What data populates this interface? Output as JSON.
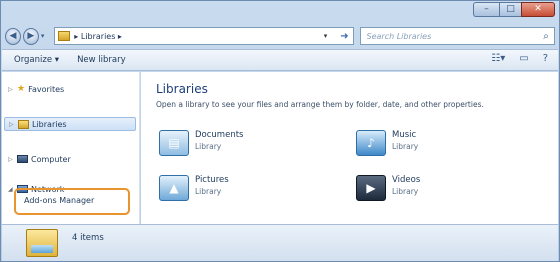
{
  "titlebar": {
    "minimize": "–",
    "maximize": "□",
    "close": "✕"
  },
  "address": {
    "path": "▸ Libraries ▸",
    "search_placeholder": "Search Libraries"
  },
  "toolbar": {
    "organize": "Organize ▾",
    "new_library": "New library"
  },
  "nav": {
    "favorites": "Favorites",
    "libraries": "Libraries",
    "computer": "Computer",
    "network": "Network",
    "highlight": "Add-ons Manager"
  },
  "main": {
    "title": "Libraries",
    "subtitle": "Open a library to see your files and arrange them by folder, date, and other properties.",
    "items": [
      {
        "name": "Documents",
        "type": "Library"
      },
      {
        "name": "Music",
        "type": "Library"
      },
      {
        "name": "Pictures",
        "type": "Library"
      },
      {
        "name": "Videos",
        "type": "Library"
      }
    ]
  },
  "details": {
    "count": "4 items"
  },
  "colors": {
    "highlight": "#e8952f",
    "accent": "#1e3f7a"
  }
}
